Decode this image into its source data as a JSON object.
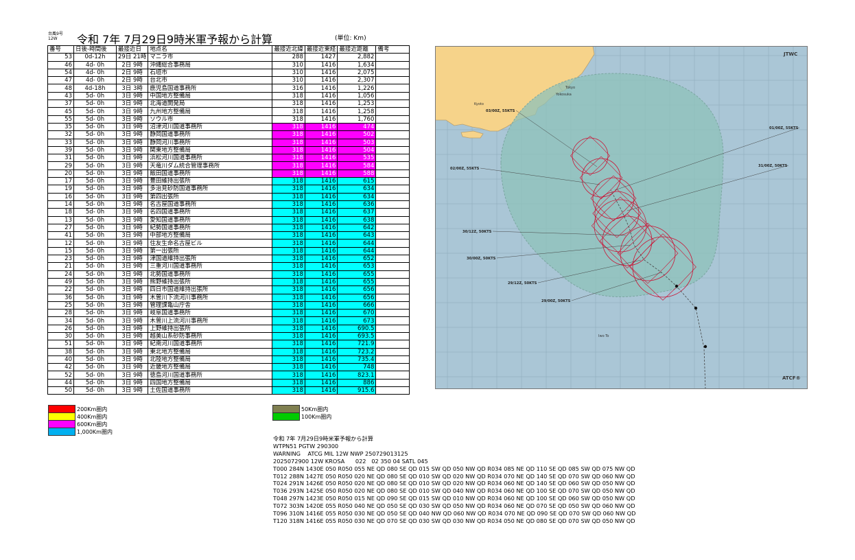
{
  "header": {
    "typhoon_no": "台風9号",
    "typhoon_code": "12W",
    "title": "令和 7年 7月29日9時米軍予報から計算",
    "unit": "(単位: Km)"
  },
  "table": {
    "columns": [
      "番号",
      "日後-時間後",
      "最接近日",
      "地点名",
      "最接近北緯",
      "最接近東経",
      "最接近距離",
      "備考"
    ],
    "rows": [
      {
        "no": "53",
        "after": "0d-12h",
        "day": "29日 21時",
        "place": "マニラ市",
        "lat": "288",
        "lon": "1427",
        "dist": "2,882",
        "color": "none"
      },
      {
        "no": "46",
        "after": "4d- 0h",
        "day": "2日 9時",
        "place": "沖縄総合事務局",
        "lat": "310",
        "lon": "1416",
        "dist": "1,634",
        "color": "none"
      },
      {
        "no": "54",
        "after": "4d- 0h",
        "day": "2日 9時",
        "place": "石垣市",
        "lat": "310",
        "lon": "1416",
        "dist": "2,075",
        "color": "none"
      },
      {
        "no": "47",
        "after": "4d- 0h",
        "day": "2日 9時",
        "place": "台北市",
        "lat": "310",
        "lon": "1416",
        "dist": "2,307",
        "color": "none"
      },
      {
        "no": "48",
        "after": "4d-18h",
        "day": "3日 3時",
        "place": "鹿児島国道事務所",
        "lat": "316",
        "lon": "1416",
        "dist": "1,226",
        "color": "none"
      },
      {
        "no": "43",
        "after": "5d- 0h",
        "day": "3日 9時",
        "place": "中国地方整備局",
        "lat": "318",
        "lon": "1416",
        "dist": "1,056",
        "color": "none"
      },
      {
        "no": "37",
        "after": "5d- 0h",
        "day": "3日 9時",
        "place": "北海道開発局",
        "lat": "318",
        "lon": "1416",
        "dist": "1,253",
        "color": "none"
      },
      {
        "no": "45",
        "after": "5d- 0h",
        "day": "3日 9時",
        "place": "九州地方整備局",
        "lat": "318",
        "lon": "1416",
        "dist": "1,258",
        "color": "none"
      },
      {
        "no": "55",
        "after": "5d- 0h",
        "day": "3日 9時",
        "place": "ソウル市",
        "lat": "318",
        "lon": "1416",
        "dist": "1,760",
        "color": "none"
      },
      {
        "no": "35",
        "after": "5d- 0h",
        "day": "3日 9時",
        "place": "沼津河川国道事務所",
        "lat": "318",
        "lon": "1416",
        "dist": "474",
        "color": "magenta"
      },
      {
        "no": "32",
        "after": "5d- 0h",
        "day": "3日 9時",
        "place": "静岡国道事務所",
        "lat": "318",
        "lon": "1416",
        "dist": "502",
        "color": "magenta"
      },
      {
        "no": "33",
        "after": "5d- 0h",
        "day": "3日 9時",
        "place": "静岡河川事務所",
        "lat": "318",
        "lon": "1416",
        "dist": "503",
        "color": "magenta"
      },
      {
        "no": "39",
        "after": "5d- 0h",
        "day": "3日 9時",
        "place": "関東地方整備局",
        "lat": "318",
        "lon": "1416",
        "dist": "504",
        "color": "magenta"
      },
      {
        "no": "31",
        "after": "5d- 0h",
        "day": "3日 9時",
        "place": "浜松河川国道事務所",
        "lat": "318",
        "lon": "1416",
        "dist": "535",
        "color": "magenta"
      },
      {
        "no": "29",
        "after": "5d- 0h",
        "day": "3日 9時",
        "place": "天竜川ダム統合管理事務所",
        "lat": "318",
        "lon": "1416",
        "dist": "584",
        "color": "magenta"
      },
      {
        "no": "20",
        "after": "5d- 0h",
        "day": "3日 9時",
        "place": "飯田国道事務所",
        "lat": "318",
        "lon": "1416",
        "dist": "588",
        "color": "magenta"
      },
      {
        "no": "17",
        "after": "5d- 0h",
        "day": "3日 9時",
        "place": "豊田維持出張所",
        "lat": "318",
        "lon": "1416",
        "dist": "615",
        "color": "cyan"
      },
      {
        "no": "19",
        "after": "5d- 0h",
        "day": "3日 9時",
        "place": "多治見砂防国道事務所",
        "lat": "318",
        "lon": "1416",
        "dist": "634",
        "color": "cyan"
      },
      {
        "no": "16",
        "after": "5d- 0h",
        "day": "3日 9時",
        "place": "第四出張所",
        "lat": "318",
        "lon": "1416",
        "dist": "634",
        "color": "cyan"
      },
      {
        "no": "14",
        "after": "5d- 0h",
        "day": "3日 9時",
        "place": "名古屋国道事務所",
        "lat": "318",
        "lon": "1416",
        "dist": "636",
        "color": "cyan"
      },
      {
        "no": "18",
        "after": "5d- 0h",
        "day": "3日 9時",
        "place": "名四国道事務所",
        "lat": "318",
        "lon": "1416",
        "dist": "637",
        "color": "cyan"
      },
      {
        "no": "13",
        "after": "5d- 0h",
        "day": "3日 9時",
        "place": "愛知国道事務所",
        "lat": "318",
        "lon": "1416",
        "dist": "638",
        "color": "cyan"
      },
      {
        "no": "27",
        "after": "5d- 0h",
        "day": "3日 9時",
        "place": "紀勢国道事務所",
        "lat": "318",
        "lon": "1416",
        "dist": "642",
        "color": "cyan"
      },
      {
        "no": "41",
        "after": "5d- 0h",
        "day": "3日 9時",
        "place": "中部地方整備局",
        "lat": "318",
        "lon": "1416",
        "dist": "643",
        "color": "cyan"
      },
      {
        "no": "12",
        "after": "5d- 0h",
        "day": "3日 9時",
        "place": "住友生命名古屋ビル",
        "lat": "318",
        "lon": "1416",
        "dist": "644",
        "color": "cyan"
      },
      {
        "no": "15",
        "after": "5d- 0h",
        "day": "3日 9時",
        "place": "第一出張所",
        "lat": "318",
        "lon": "1416",
        "dist": "644",
        "color": "cyan"
      },
      {
        "no": "23",
        "after": "5d- 0h",
        "day": "3日 9時",
        "place": "津国道維持出張所",
        "lat": "318",
        "lon": "1416",
        "dist": "652",
        "color": "cyan"
      },
      {
        "no": "21",
        "after": "5d- 0h",
        "day": "3日 9時",
        "place": "三重河川国道事務所",
        "lat": "318",
        "lon": "1416",
        "dist": "653",
        "color": "cyan"
      },
      {
        "no": "24",
        "after": "5d- 0h",
        "day": "3日 9時",
        "place": "北勢国道事務所",
        "lat": "318",
        "lon": "1416",
        "dist": "655",
        "color": "cyan"
      },
      {
        "no": "49",
        "after": "5d- 0h",
        "day": "3日 9時",
        "place": "熊野維持出張所",
        "lat": "318",
        "lon": "1416",
        "dist": "655",
        "color": "cyan"
      },
      {
        "no": "22",
        "after": "5d- 0h",
        "day": "3日 9時",
        "place": "四日市国道維持出張所",
        "lat": "318",
        "lon": "1416",
        "dist": "656",
        "color": "cyan"
      },
      {
        "no": "36",
        "after": "5d- 0h",
        "day": "3日 9時",
        "place": "木曽川下流河川事務所",
        "lat": "318",
        "lon": "1416",
        "dist": "656",
        "color": "cyan"
      },
      {
        "no": "25",
        "after": "5d- 0h",
        "day": "3日 9時",
        "place": "管理課亀山庁舎",
        "lat": "318",
        "lon": "1416",
        "dist": "666",
        "color": "cyan"
      },
      {
        "no": "28",
        "after": "5d- 0h",
        "day": "3日 9時",
        "place": "岐阜国道事務所",
        "lat": "318",
        "lon": "1416",
        "dist": "670",
        "color": "cyan"
      },
      {
        "no": "34",
        "after": "5d- 0h",
        "day": "3日 9時",
        "place": "木曽川上流河川事務所",
        "lat": "318",
        "lon": "1416",
        "dist": "673",
        "color": "cyan"
      },
      {
        "no": "26",
        "after": "5d- 0h",
        "day": "3日 9時",
        "place": "上野維持出張所",
        "lat": "318",
        "lon": "1416",
        "dist": "690.5",
        "color": "cyan"
      },
      {
        "no": "30",
        "after": "5d- 0h",
        "day": "3日 9時",
        "place": "越美山系砂防事務所",
        "lat": "318",
        "lon": "1416",
        "dist": "693.5",
        "color": "cyan"
      },
      {
        "no": "51",
        "after": "5d- 0h",
        "day": "3日 9時",
        "place": "紀南河川国道事務所",
        "lat": "318",
        "lon": "1416",
        "dist": "721.9",
        "color": "cyan"
      },
      {
        "no": "38",
        "after": "5d- 0h",
        "day": "3日 9時",
        "place": "東北地方整備局",
        "lat": "318",
        "lon": "1416",
        "dist": "723.2",
        "color": "cyan"
      },
      {
        "no": "40",
        "after": "5d- 0h",
        "day": "3日 9時",
        "place": "北陸地方整備局",
        "lat": "318",
        "lon": "1416",
        "dist": "735.4",
        "color": "cyan"
      },
      {
        "no": "42",
        "after": "5d- 0h",
        "day": "3日 9時",
        "place": "近畿地方整備局",
        "lat": "318",
        "lon": "1416",
        "dist": "748",
        "color": "cyan"
      },
      {
        "no": "52",
        "after": "5d- 0h",
        "day": "3日 9時",
        "place": "徳島河川国道事務所",
        "lat": "318",
        "lon": "1416",
        "dist": "823.1",
        "color": "cyan"
      },
      {
        "no": "44",
        "after": "5d- 0h",
        "day": "3日 9時",
        "place": "四国地方整備局",
        "lat": "318",
        "lon": "1416",
        "dist": "886",
        "color": "cyan"
      },
      {
        "no": "50",
        "after": "5d- 0h",
        "day": "3日 9時",
        "place": "土佐国道事務所",
        "lat": "318",
        "lon": "1416",
        "dist": "915.6",
        "color": "cyan"
      }
    ]
  },
  "legend": {
    "left": [
      {
        "label": "200Km圏内",
        "color": "#ff0000"
      },
      {
        "label": "400Km圏内",
        "color": "#ffff00"
      },
      {
        "label": "600Km圏内",
        "color": "#ff00ff"
      },
      {
        "label": "1,000Km圏内",
        "color": "#00b0f0"
      }
    ],
    "right": [
      {
        "label": "50Km圏内",
        "color": "#7f7f50"
      },
      {
        "label": "100Km圏内",
        "color": "#00cc00"
      }
    ]
  },
  "bulletin": {
    "lines": [
      "令和 7年 7月29日9時米軍予報から計算",
      "WTPN51 PGTW 290300",
      "WARNING    ATCG MIL 12W NWP 250729013125",
      "2025072900 12W KROSA      022   02 350 04 SATL 045",
      "T000 284N 1430E 050 R050 055 NE QD 080 SE QD 015 SW QD 050 NW QD R034 085 NE QD 110 SE QD 085 SW QD 075 NW QD",
      "T012 288N 1427E 050 R050 020 NE QD 080 SE QD 010 SW QD 020 NW QD R034 070 NE QD 140 SE QD 070 SW QD 060 NW QD",
      "T024 291N 1426E 050 R050 020 NE QD 080 SE QD 010 SW QD 020 NW QD R034 060 NE QD 140 SE QD 060 SW QD 050 NW QD",
      "T036 293N 1425E 050 R050 020 NE QD 080 SE QD 010 SW QD 040 NW QD R034 060 NE QD 100 SE QD 070 SW QD 050 NW QD",
      "T048 297N 1423E 050 R050 015 NE QD 090 SE QD 015 SW QD 010 NW QD R034 060 NE QD 100 SE QD 060 SW QD 050 NW QD",
      "T072 303N 1420E 055 R050 040 NE QD 050 SE QD 030 SW QD 050 NW QD R034 060 NE QD 070 SE QD 050 SW QD 060 NW QD",
      "T096 310N 1416E 055 R050 030 NE QD 050 SE QD 040 NW QD 060 NW QD R034 070 NE QD 090 SE QD 070 SW QD 060 NW QD",
      "T120 318N 1416E 055 R050 030 NE QD 070 SE QD 030 SW QD 030 NW QD R034 050 NE QD 080 SE QD 070 SW QD 050 NW QD"
    ]
  },
  "map": {
    "brand_top": "JTWC",
    "brand_bottom": "ATCF®",
    "cities": [
      "Tokyo",
      "Yokosuka",
      "Kyoto"
    ],
    "storm_label": "Iwo To",
    "forecast_labels": [
      "03/00Z, 55KTS",
      "01/00Z, 55KTS",
      "02/00Z, 55KTS",
      "31/00Z, 50KTS",
      "30/12Z, 50KTS",
      "30/00Z, 50KTS",
      "29/12Z, 50KTS",
      "29/00Z, 50KTS"
    ],
    "colors": {
      "ocean": "#aac6d6",
      "land": "#f6d38a",
      "danger": "#8ec1ba",
      "track": "#cc1133"
    }
  }
}
